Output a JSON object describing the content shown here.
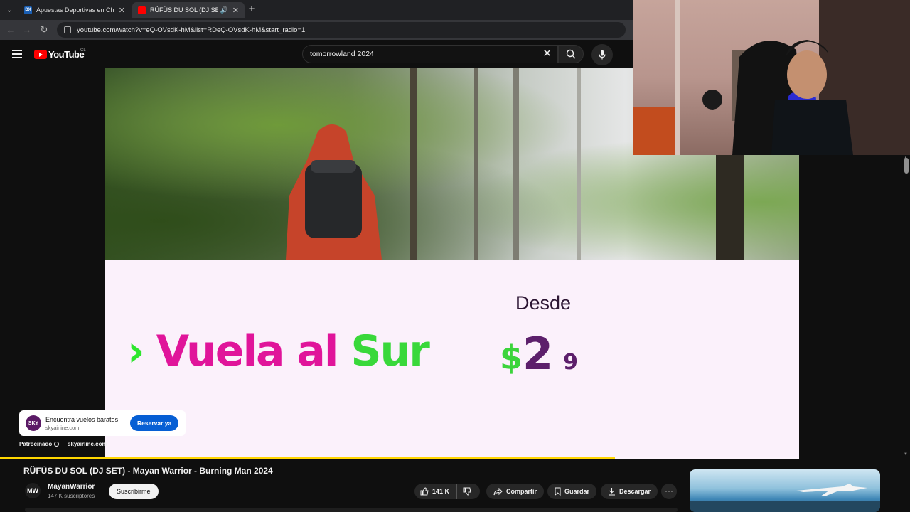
{
  "browser": {
    "tabs": [
      {
        "favicon": "DX",
        "title": "Apuestas Deportivas en Chile |",
        "active": false
      },
      {
        "favicon": "yt",
        "title": "RÜFÜS DU SOL (DJ SET) - M",
        "active": true
      }
    ],
    "url": "youtube.com/watch?v=eQ-OVsdK-hM&list=RDeQ-OVsdK-hM&start_radio=1"
  },
  "youtube": {
    "logo_text": "YouTube",
    "country": "CL",
    "search_query": "tomorrowland 2024"
  },
  "ad_video": {
    "slogan_chevron": "›",
    "slogan_part1": "Vuela al",
    "slogan_part2": "Sur",
    "desde": "Desde",
    "price_symbol": "$",
    "price_digit": "2",
    "price_partial": "9",
    "brand_color_pink": "#e0159a",
    "brand_color_green": "#39d83a",
    "brand_color_purple": "#5c1f6b"
  },
  "ad_overlay": {
    "avatar_text": "SKY",
    "title": "Encuentra vuelos baratos",
    "domain": "skyairline.com",
    "cta": "Reservar ya",
    "sponsored_label": "Patrocinado",
    "sponsor_domain": "skyairline.com"
  },
  "playback": {
    "progress_fraction": 0.77
  },
  "video": {
    "title": "RÜFÜS DU SOL (DJ SET) - Mayan Warrior - Burning Man 2024",
    "channel_avatar": "MW",
    "channel": "MayanWarrior",
    "subscribers": "147 K suscriptores",
    "subscribe_label": "Suscribirme",
    "likes": "141 K",
    "share_label": "Compartir",
    "save_label": "Guardar",
    "download_label": "Descargar",
    "more_label": "···"
  }
}
